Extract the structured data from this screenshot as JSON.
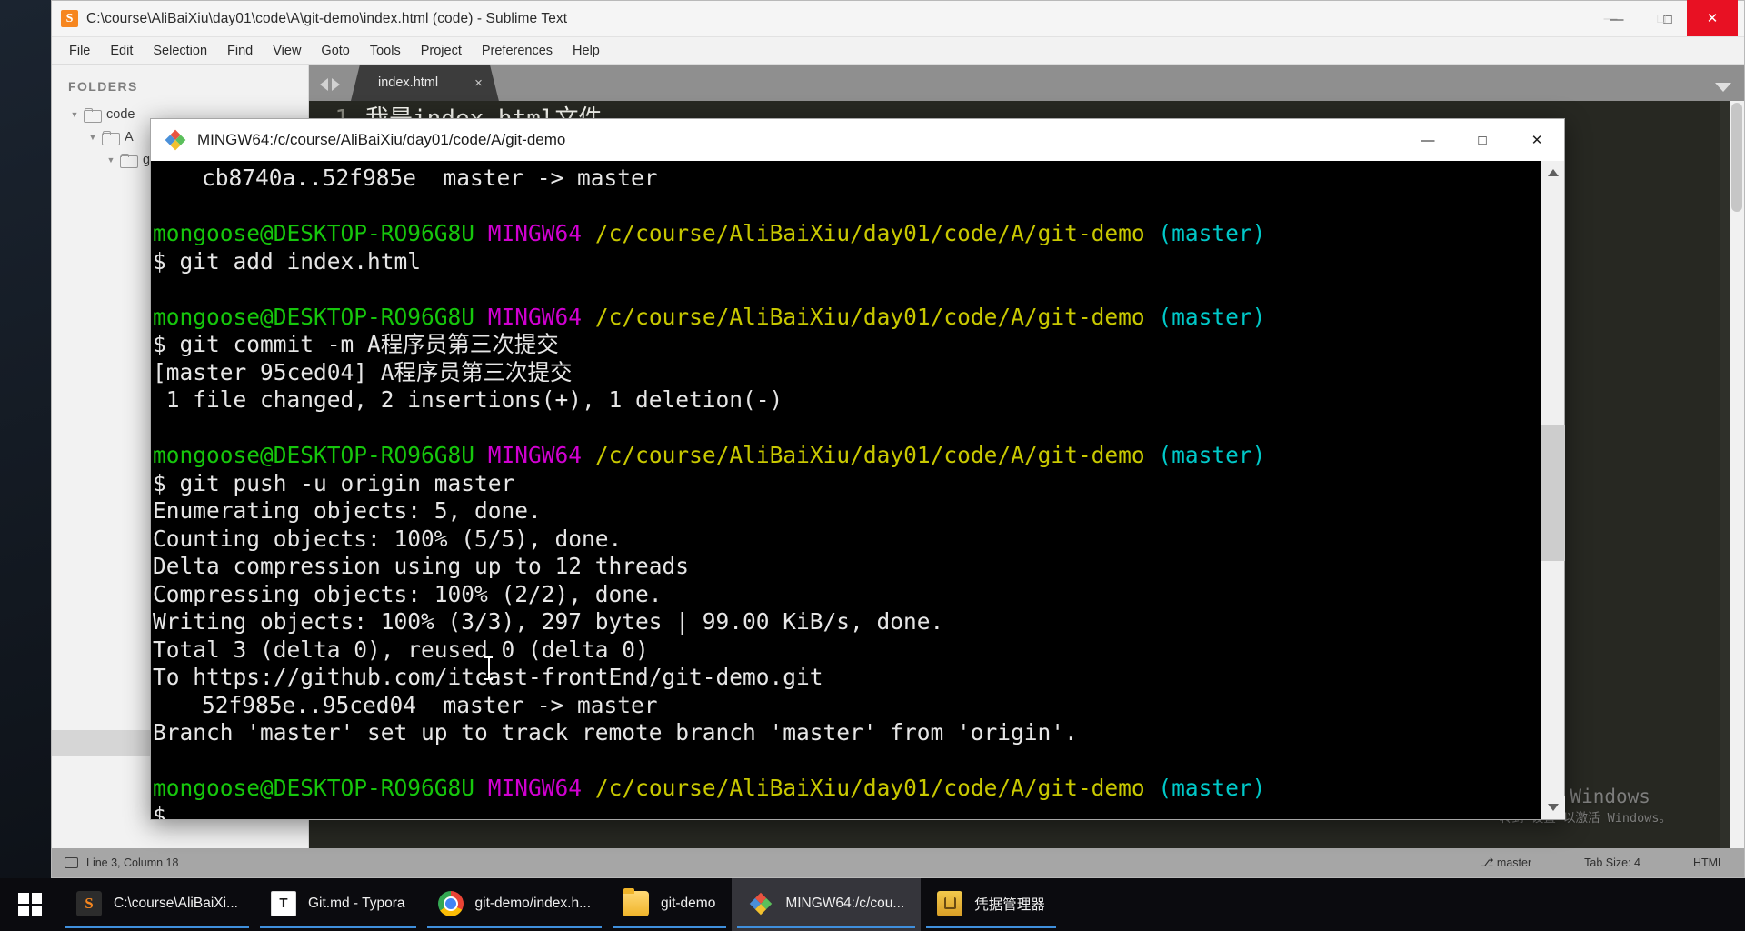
{
  "sublime": {
    "title": "C:\\course\\AliBaiXiu\\day01\\code\\A\\git-demo\\index.html (code) - Sublime Text",
    "logo_glyph": "S",
    "menu": [
      {
        "label": "File"
      },
      {
        "label": "Edit"
      },
      {
        "label": "Selection"
      },
      {
        "label": "Find"
      },
      {
        "label": "View"
      },
      {
        "label": "Goto"
      },
      {
        "label": "Tools"
      },
      {
        "label": "Project"
      },
      {
        "label": "Preferences"
      },
      {
        "label": "Help"
      }
    ],
    "window_controls": {
      "minimize": "—",
      "maximize": "□",
      "close": "✕"
    },
    "sidebar": {
      "heading": "FOLDERS",
      "tree": [
        {
          "label": "code",
          "arrow": "▼",
          "icon": "folder-icon"
        },
        {
          "label": "A",
          "arrow": "▼",
          "icon": "folder-icon"
        },
        {
          "label": "g",
          "arrow": "▼",
          "icon": "folder-icon"
        },
        {
          "label": "<>",
          "arrow": "",
          "icon": "file-icon"
        }
      ]
    },
    "tabbar": {
      "tab_label": "index.html",
      "close_glyph": "×",
      "nav_prev": "prev-tab-arrow",
      "nav_next": "next-tab-arrow",
      "dropdown": "tab-list-dropdown"
    },
    "editor": {
      "lines": [
        {
          "num": "1",
          "text": "我是index.html文件"
        }
      ]
    },
    "statusbar": {
      "cursor": "Line 3, Column 18",
      "branch": "master",
      "branch_glyph": "⎇",
      "tab_size": "Tab Size: 4",
      "syntax": "HTML"
    },
    "watermark": {
      "line1": "激活 Windows",
      "line2": "转到“设置”以激活 Windows。"
    }
  },
  "mingw": {
    "title": "MINGW64:/c/course/AliBaiXiu/day01/code/A/git-demo",
    "icon": "git-bash-icon",
    "window_controls": {
      "minimize": "—",
      "maximize": "□",
      "close": "✕"
    },
    "colors": {
      "user_host": "#16c60c",
      "shell": "#d000d0",
      "path": "#c8c800",
      "branch": "#00c8c8",
      "text": "#e6e6e6",
      "background": "#000000"
    },
    "prompt": {
      "user_host": "mongoose@DESKTOP-RO96G8U",
      "shell": "MINGW64",
      "path": "/c/course/AliBaiXiu/day01/code/A/git-demo",
      "branch": "(master)"
    },
    "scroll": {
      "up_arrow": "scroll-up-arrow",
      "down_arrow": "scroll-down-arrow",
      "thumb": "scrollbar-thumb"
    },
    "lines": [
      {
        "type": "out",
        "indent": true,
        "text": "cb8740a..52f985e  master -> master"
      },
      {
        "type": "blank",
        "text": ""
      },
      {
        "type": "prompt"
      },
      {
        "type": "cmd",
        "text": "$ git add index.html"
      },
      {
        "type": "blank",
        "text": ""
      },
      {
        "type": "prompt"
      },
      {
        "type": "cmd",
        "text": "$ git commit -m A程序员第三次提交"
      },
      {
        "type": "out",
        "text": "[master 95ced04] A程序员第三次提交"
      },
      {
        "type": "out",
        "text": " 1 file changed, 2 insertions(+), 1 deletion(-)"
      },
      {
        "type": "blank",
        "text": ""
      },
      {
        "type": "prompt"
      },
      {
        "type": "cmd",
        "text": "$ git push -u origin master"
      },
      {
        "type": "out",
        "text": "Enumerating objects: 5, done."
      },
      {
        "type": "out",
        "text": "Counting objects: 100% (5/5), done."
      },
      {
        "type": "out",
        "text": "Delta compression using up to 12 threads"
      },
      {
        "type": "out",
        "text": "Compressing objects: 100% (2/2), done."
      },
      {
        "type": "out",
        "text": "Writing objects: 100% (3/3), 297 bytes | 99.00 KiB/s, done."
      },
      {
        "type": "out",
        "text": "Total 3 (delta 0), reused 0 (delta 0)"
      },
      {
        "type": "out",
        "text": "To https://github.com/itcast-frontEnd/git-demo.git"
      },
      {
        "type": "out",
        "indent": true,
        "text": "52f985e..95ced04  master -> master"
      },
      {
        "type": "out",
        "text": "Branch 'master' set up to track remote branch 'master' from 'origin'."
      },
      {
        "type": "blank",
        "text": ""
      },
      {
        "type": "prompt"
      },
      {
        "type": "cmd",
        "text": "$"
      }
    ]
  },
  "taskbar": {
    "start": "windows-start-icon",
    "items": [
      {
        "label": "C:\\course\\AliBaiXi...",
        "icon": "sublime-text-icon",
        "active": false
      },
      {
        "label": "Git.md - Typora",
        "icon": "typora-icon",
        "active": false
      },
      {
        "label": "git-demo/index.h...",
        "icon": "chrome-icon",
        "active": false
      },
      {
        "label": "git-demo",
        "icon": "folder-icon",
        "active": false
      },
      {
        "label": "MINGW64:/c/cou...",
        "icon": "git-bash-icon",
        "active": true
      },
      {
        "label": "凭据管理器",
        "icon": "credential-manager-icon",
        "active": false
      }
    ]
  },
  "outer_frame": {
    "minimize": "—",
    "maximize": "□",
    "close": "✕"
  }
}
